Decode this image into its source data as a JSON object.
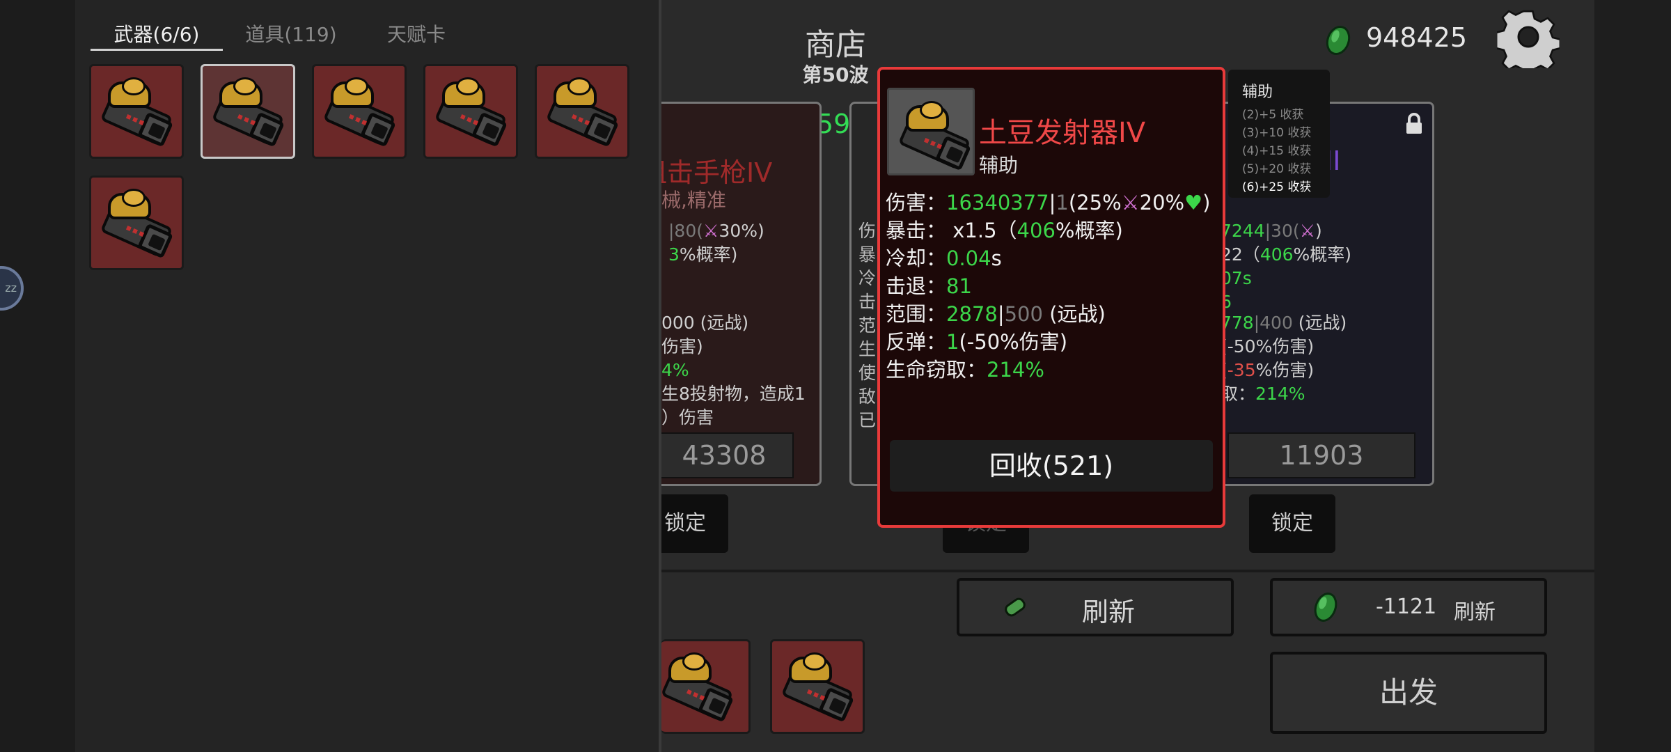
{
  "inventory": {
    "tabs": [
      "武器(6/6)",
      "道具(119)",
      "天赋卡"
    ],
    "weapon_slots": 6
  },
  "header": {
    "title": "商店",
    "wave": "第50波",
    "money": "948425"
  },
  "fps": "FPS59",
  "shop_cards": {
    "left": {
      "name_partial": "狙击手枪IV",
      "tags_partial": "械,精准",
      "lines": [
        "|80(",
        "30%",
        ")",
        "3%概率)",
        "000 (远战)",
        "伤害)",
        "4%",
        "生8投射物，造成1",
        "）伤害"
      ],
      "price": "43308",
      "lock_label": "锁定"
    },
    "middle": {
      "letters": [
        "伤",
        "暴",
        "冷",
        "击",
        "范",
        "生",
        "使",
        "敌",
        "已"
      ],
      "lock_label": "锁定"
    },
    "right": {
      "name_partial": "II",
      "lines": [
        "7244|30(",
        "22（406%概率)",
        "07s",
        "6",
        "778|400 (远战)",
        "(-50%伤害)",
        "(-35%伤害)",
        "取：214%"
      ],
      "price": "11903",
      "lock_label": "锁定"
    }
  },
  "tooltip": {
    "title": "辅助",
    "lines": [
      {
        "text": "(2)+5 收获",
        "active": false
      },
      {
        "text": "(3)+10 收获",
        "active": false
      },
      {
        "text": "(4)+15 收获",
        "active": false
      },
      {
        "text": "(5)+20 收获",
        "active": false
      },
      {
        "text": "(6)+25 收获",
        "active": true
      }
    ]
  },
  "popup": {
    "name": "土豆发射器IV",
    "type": "辅助",
    "stats": {
      "damage_label": "伤害：",
      "damage_value": "16340377",
      "damage_base": "1",
      "damage_scale": "(25%",
      "damage_scale2": "20%",
      "crit_label": "暴击：",
      "crit_mult": "x1.5",
      "crit_chance": "406",
      "crit_suffix": "%概率)",
      "cooldown_label": "冷却：",
      "cooldown_value": "0.04",
      "cooldown_unit": "s",
      "knockback_label": "击退：",
      "knockback_value": "81",
      "range_label": "范围：",
      "range_value": "2878",
      "range_base": "500",
      "range_type": "(远战)",
      "bounce_label": "反弹：",
      "bounce_value": "1",
      "bounce_suffix": "(-50%伤害)",
      "lifesteal_label": "生命窃取：",
      "lifesteal_value": "214%"
    },
    "recycle_label": "回收(521)"
  },
  "buttons": {
    "refresh": "刷新",
    "refresh_cost": "-1121",
    "refresh_paid_label": "刷新",
    "depart": "出发"
  },
  "colors": {
    "accent_red": "#e83a3a",
    "stat_green": "#3cd64a",
    "slot_red": "#6b2828"
  }
}
